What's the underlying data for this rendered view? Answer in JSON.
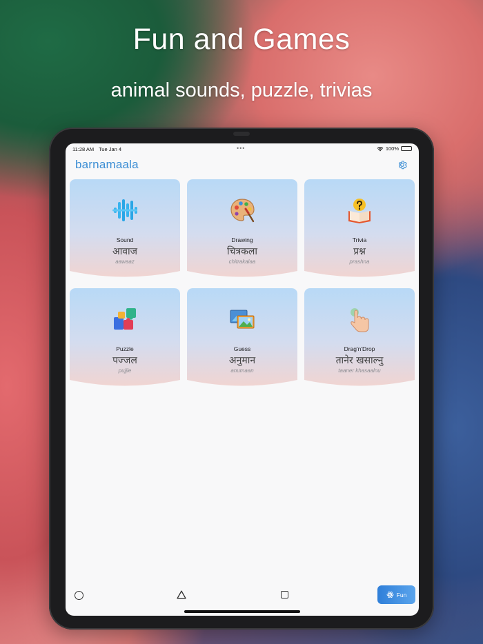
{
  "hero": {
    "title": "Fun and Games",
    "subtitle": "animal sounds, puzzle, trivias"
  },
  "status_bar": {
    "time": "11:28 AM",
    "date": "Tue Jan 4",
    "battery": "100%",
    "battery_level": 1.0
  },
  "app": {
    "title": "barnamaala",
    "accent_color": "#3c8ed4"
  },
  "cards": [
    {
      "en": "Sound",
      "hi": "आवाज",
      "tr": "aawaaz",
      "icon": "sound-wave-icon"
    },
    {
      "en": "Drawing",
      "hi": "चित्रकला",
      "tr": "chitrakalaa",
      "icon": "palette-icon"
    },
    {
      "en": "Trivia",
      "hi": "प्रश्न",
      "tr": "prashna",
      "icon": "question-book-icon"
    },
    {
      "en": "Puzzle",
      "hi": "पज्जल",
      "tr": "pujjle",
      "icon": "puzzle-icon"
    },
    {
      "en": "Guess",
      "hi": "अनुमान",
      "tr": "anumaan",
      "icon": "pictures-icon"
    },
    {
      "en": "Drag'n'Drop",
      "hi": "तानेर खसाल्नु",
      "tr": "taaner khasaalnu",
      "icon": "hand-pointer-icon"
    }
  ],
  "bottom": {
    "fun_label": "Fun"
  }
}
